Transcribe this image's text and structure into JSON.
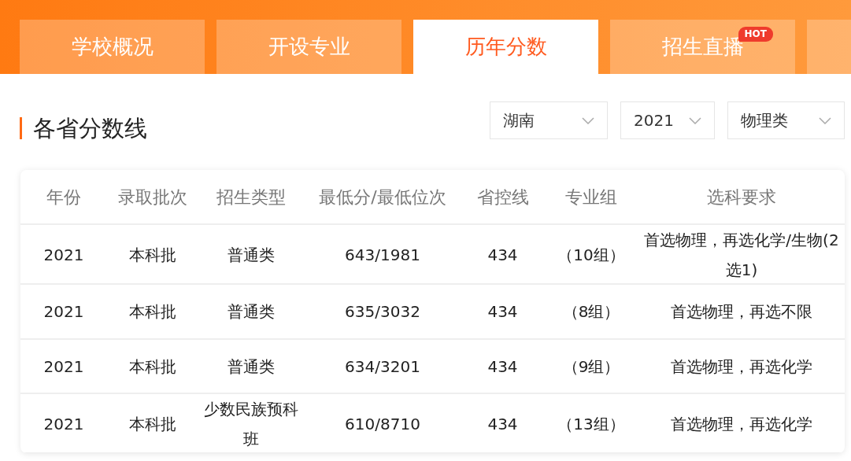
{
  "tabs": [
    {
      "label": "学校概况",
      "selected": false
    },
    {
      "label": "开设专业",
      "selected": false
    },
    {
      "label": "历年分数",
      "selected": true
    },
    {
      "label": "招生直播",
      "selected": false,
      "badge": "HOT"
    },
    {
      "selected": false
    }
  ],
  "section": {
    "title": "各省分数线",
    "filters": [
      {
        "kind": "province",
        "value": "湖南"
      },
      {
        "kind": "year",
        "value": "2021"
      },
      {
        "kind": "category",
        "value": "物理类"
      }
    ]
  },
  "table": {
    "columns": [
      "年份",
      "录取批次",
      "招生类型",
      "最低分/最低位次",
      "省控线",
      "专业组",
      "选科要求"
    ],
    "rows": [
      [
        "2021",
        "本科批",
        "普通类",
        "643/1981",
        "434",
        "（10组）",
        "首选物理，再选化学/生物(2选1)"
      ],
      [
        "2021",
        "本科批",
        "普通类",
        "635/3032",
        "434",
        "（8组）",
        "首选物理，再选不限"
      ],
      [
        "2021",
        "本科批",
        "普通类",
        "634/3201",
        "434",
        "（9组）",
        "首选物理，再选化学"
      ],
      [
        "2021",
        "本科批",
        "少数民族预科班",
        "610/8710",
        "434",
        "（13组）",
        "首选物理，再选化学"
      ]
    ]
  }
}
